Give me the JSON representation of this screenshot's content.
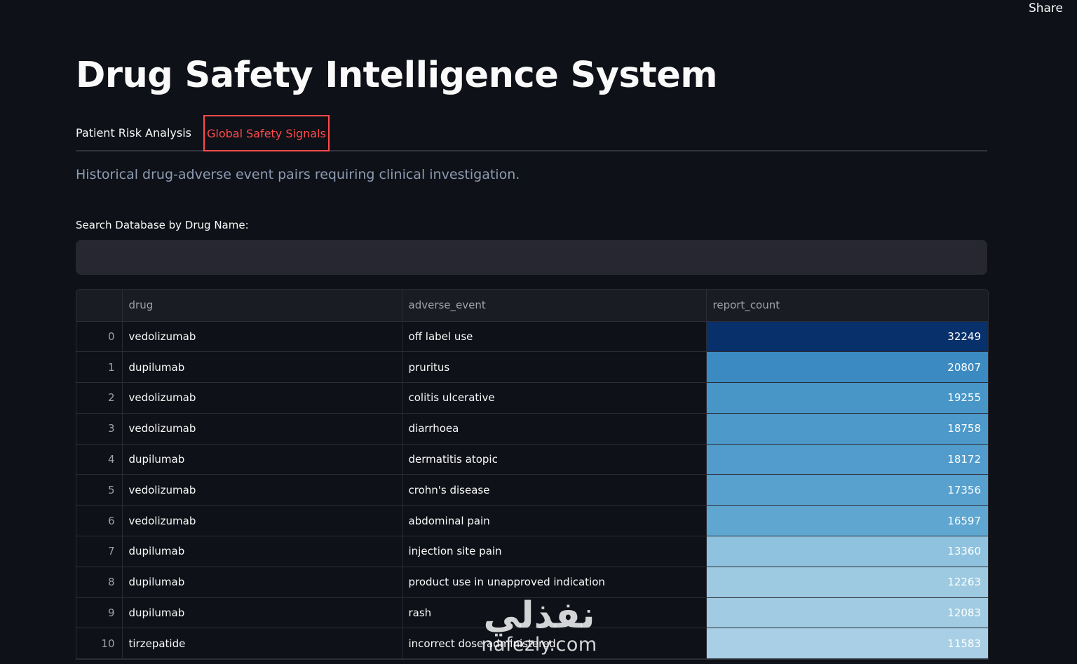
{
  "header": {
    "share_label": "Share"
  },
  "page": {
    "title": "Drug Safety Intelligence System",
    "tabs": [
      {
        "label": "Patient Risk Analysis",
        "active": false
      },
      {
        "label": "Global Safety Signals",
        "active": true
      }
    ],
    "caption": "Historical drug-adverse event pairs requiring clinical investigation.",
    "accent_color": "#ff4b4b"
  },
  "search": {
    "label": "Search Database by Drug Name:",
    "value": "",
    "placeholder": ""
  },
  "table": {
    "columns": [
      "",
      "drug",
      "adverse_event",
      "report_count"
    ],
    "rows": [
      {
        "index": "0",
        "drug": "vedolizumab",
        "adverse_event": "off label use",
        "report_count": "32249",
        "shade": "#08306b"
      },
      {
        "index": "1",
        "drug": "dupilumab",
        "adverse_event": "pruritus",
        "report_count": "20807",
        "shade": "#3b8bc2"
      },
      {
        "index": "2",
        "drug": "vedolizumab",
        "adverse_event": "colitis ulcerative",
        "report_count": "19255",
        "shade": "#4896c8"
      },
      {
        "index": "3",
        "drug": "vedolizumab",
        "adverse_event": "diarrhoea",
        "report_count": "18758",
        "shade": "#4c99ca"
      },
      {
        "index": "4",
        "drug": "dupilumab",
        "adverse_event": "dermatitis atopic",
        "report_count": "18172",
        "shade": "#519ccc"
      },
      {
        "index": "5",
        "drug": "vedolizumab",
        "adverse_event": "crohn's disease",
        "report_count": "17356",
        "shade": "#58a1cf"
      },
      {
        "index": "6",
        "drug": "vedolizumab",
        "adverse_event": "abdominal pain",
        "report_count": "16597",
        "shade": "#5fa6d1"
      },
      {
        "index": "7",
        "drug": "dupilumab",
        "adverse_event": "injection site pain",
        "report_count": "13360",
        "shade": "#8fc2de"
      },
      {
        "index": "8",
        "drug": "dupilumab",
        "adverse_event": "product use in unapproved indication",
        "report_count": "12263",
        "shade": "#9dcae1"
      },
      {
        "index": "9",
        "drug": "dupilumab",
        "adverse_event": "rash",
        "report_count": "12083",
        "shade": "#a0cbe2"
      },
      {
        "index": "10",
        "drug": "tirzepatide",
        "adverse_event": "incorrect dose administered",
        "report_count": "11583",
        "shade": "#a8cfe5"
      }
    ]
  },
  "watermark": {
    "arabic": "نفذلي",
    "latin": "nafezly.com"
  }
}
